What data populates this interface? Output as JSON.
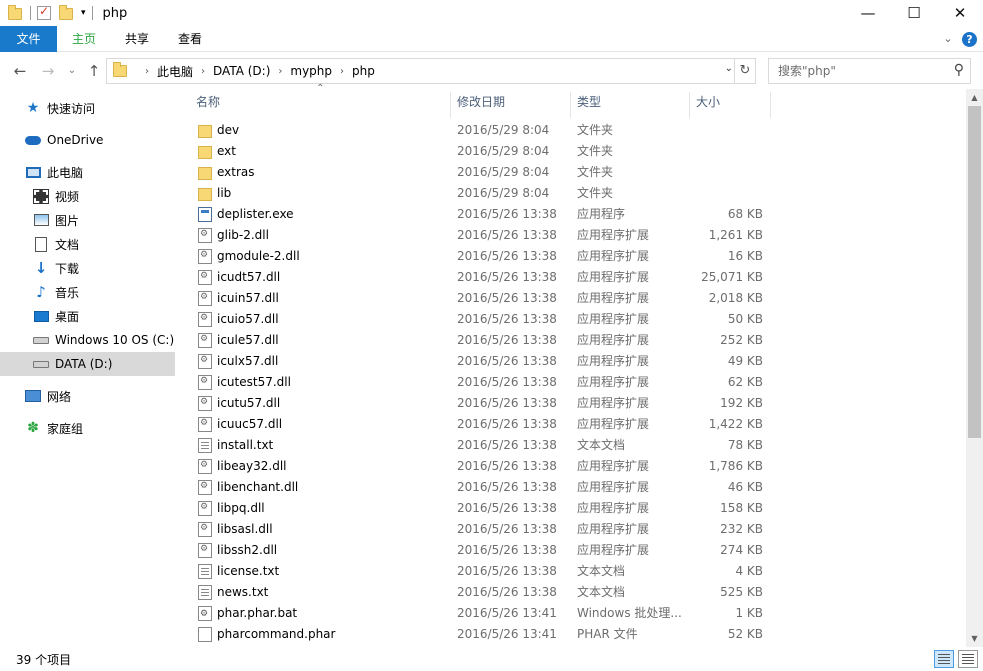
{
  "window": {
    "title": "php",
    "minimize": "—",
    "maximize": "☐",
    "close": "✕"
  },
  "ribbon": {
    "tabs": [
      "文件",
      "主页",
      "共享",
      "查看"
    ],
    "collapse": "⌄",
    "help": "?"
  },
  "nav": {
    "back": "←",
    "forward": "→",
    "recent": "⌄",
    "up": "↑"
  },
  "address": {
    "crumbs": [
      "此电脑",
      "DATA (D:)",
      "myphp",
      "php"
    ],
    "dropdown": "⌄",
    "refresh": "↻"
  },
  "search": {
    "placeholder": "搜索\"php\"",
    "icon": "⚲"
  },
  "sidebar": {
    "items": [
      {
        "label": "快速访问",
        "icon": "star-icon"
      },
      {
        "label": "OneDrive",
        "icon": "cloud-icon"
      },
      {
        "label": "此电脑",
        "icon": "computer-icon"
      },
      {
        "label": "视频",
        "icon": "video-icon"
      },
      {
        "label": "图片",
        "icon": "pictures-icon"
      },
      {
        "label": "文档",
        "icon": "documents-icon"
      },
      {
        "label": "下载",
        "icon": "download-icon"
      },
      {
        "label": "音乐",
        "icon": "music-icon"
      },
      {
        "label": "桌面",
        "icon": "desktop-icon"
      },
      {
        "label": "Windows 10 OS (C:)",
        "icon": "drive-icon"
      },
      {
        "label": "DATA (D:)",
        "icon": "drive-icon",
        "selected": true
      },
      {
        "label": "网络",
        "icon": "network-icon"
      },
      {
        "label": "家庭组",
        "icon": "homegroup-icon"
      }
    ]
  },
  "columns": {
    "name": "名称",
    "date": "修改日期",
    "type": "类型",
    "size": "大小"
  },
  "files": [
    {
      "name": "dev",
      "date": "2016/5/29 8:04",
      "type": "文件夹",
      "size": "",
      "icon": "folder"
    },
    {
      "name": "ext",
      "date": "2016/5/29 8:04",
      "type": "文件夹",
      "size": "",
      "icon": "folder"
    },
    {
      "name": "extras",
      "date": "2016/5/29 8:04",
      "type": "文件夹",
      "size": "",
      "icon": "folder"
    },
    {
      "name": "lib",
      "date": "2016/5/29 8:04",
      "type": "文件夹",
      "size": "",
      "icon": "folder"
    },
    {
      "name": "deplister.exe",
      "date": "2016/5/26 13:38",
      "type": "应用程序",
      "size": "68 KB",
      "icon": "exe"
    },
    {
      "name": "glib-2.dll",
      "date": "2016/5/26 13:38",
      "type": "应用程序扩展",
      "size": "1,261 KB",
      "icon": "dll"
    },
    {
      "name": "gmodule-2.dll",
      "date": "2016/5/26 13:38",
      "type": "应用程序扩展",
      "size": "16 KB",
      "icon": "dll"
    },
    {
      "name": "icudt57.dll",
      "date": "2016/5/26 13:38",
      "type": "应用程序扩展",
      "size": "25,071 KB",
      "icon": "dll"
    },
    {
      "name": "icuin57.dll",
      "date": "2016/5/26 13:38",
      "type": "应用程序扩展",
      "size": "2,018 KB",
      "icon": "dll"
    },
    {
      "name": "icuio57.dll",
      "date": "2016/5/26 13:38",
      "type": "应用程序扩展",
      "size": "50 KB",
      "icon": "dll"
    },
    {
      "name": "icule57.dll",
      "date": "2016/5/26 13:38",
      "type": "应用程序扩展",
      "size": "252 KB",
      "icon": "dll"
    },
    {
      "name": "iculx57.dll",
      "date": "2016/5/26 13:38",
      "type": "应用程序扩展",
      "size": "49 KB",
      "icon": "dll"
    },
    {
      "name": "icutest57.dll",
      "date": "2016/5/26 13:38",
      "type": "应用程序扩展",
      "size": "62 KB",
      "icon": "dll"
    },
    {
      "name": "icutu57.dll",
      "date": "2016/5/26 13:38",
      "type": "应用程序扩展",
      "size": "192 KB",
      "icon": "dll"
    },
    {
      "name": "icuuc57.dll",
      "date": "2016/5/26 13:38",
      "type": "应用程序扩展",
      "size": "1,422 KB",
      "icon": "dll"
    },
    {
      "name": "install.txt",
      "date": "2016/5/26 13:38",
      "type": "文本文档",
      "size": "78 KB",
      "icon": "txt"
    },
    {
      "name": "libeay32.dll",
      "date": "2016/5/26 13:38",
      "type": "应用程序扩展",
      "size": "1,786 KB",
      "icon": "dll"
    },
    {
      "name": "libenchant.dll",
      "date": "2016/5/26 13:38",
      "type": "应用程序扩展",
      "size": "46 KB",
      "icon": "dll"
    },
    {
      "name": "libpq.dll",
      "date": "2016/5/26 13:38",
      "type": "应用程序扩展",
      "size": "158 KB",
      "icon": "dll"
    },
    {
      "name": "libsasl.dll",
      "date": "2016/5/26 13:38",
      "type": "应用程序扩展",
      "size": "232 KB",
      "icon": "dll"
    },
    {
      "name": "libssh2.dll",
      "date": "2016/5/26 13:38",
      "type": "应用程序扩展",
      "size": "274 KB",
      "icon": "dll"
    },
    {
      "name": "license.txt",
      "date": "2016/5/26 13:38",
      "type": "文本文档",
      "size": "4 KB",
      "icon": "txt"
    },
    {
      "name": "news.txt",
      "date": "2016/5/26 13:38",
      "type": "文本文档",
      "size": "525 KB",
      "icon": "txt"
    },
    {
      "name": "phar.phar.bat",
      "date": "2016/5/26 13:41",
      "type": "Windows 批处理...",
      "size": "1 KB",
      "icon": "bat"
    },
    {
      "name": "pharcommand.phar",
      "date": "2016/5/26 13:41",
      "type": "PHAR 文件",
      "size": "52 KB",
      "icon": "blank"
    }
  ],
  "status": {
    "count": "39 个项目"
  }
}
